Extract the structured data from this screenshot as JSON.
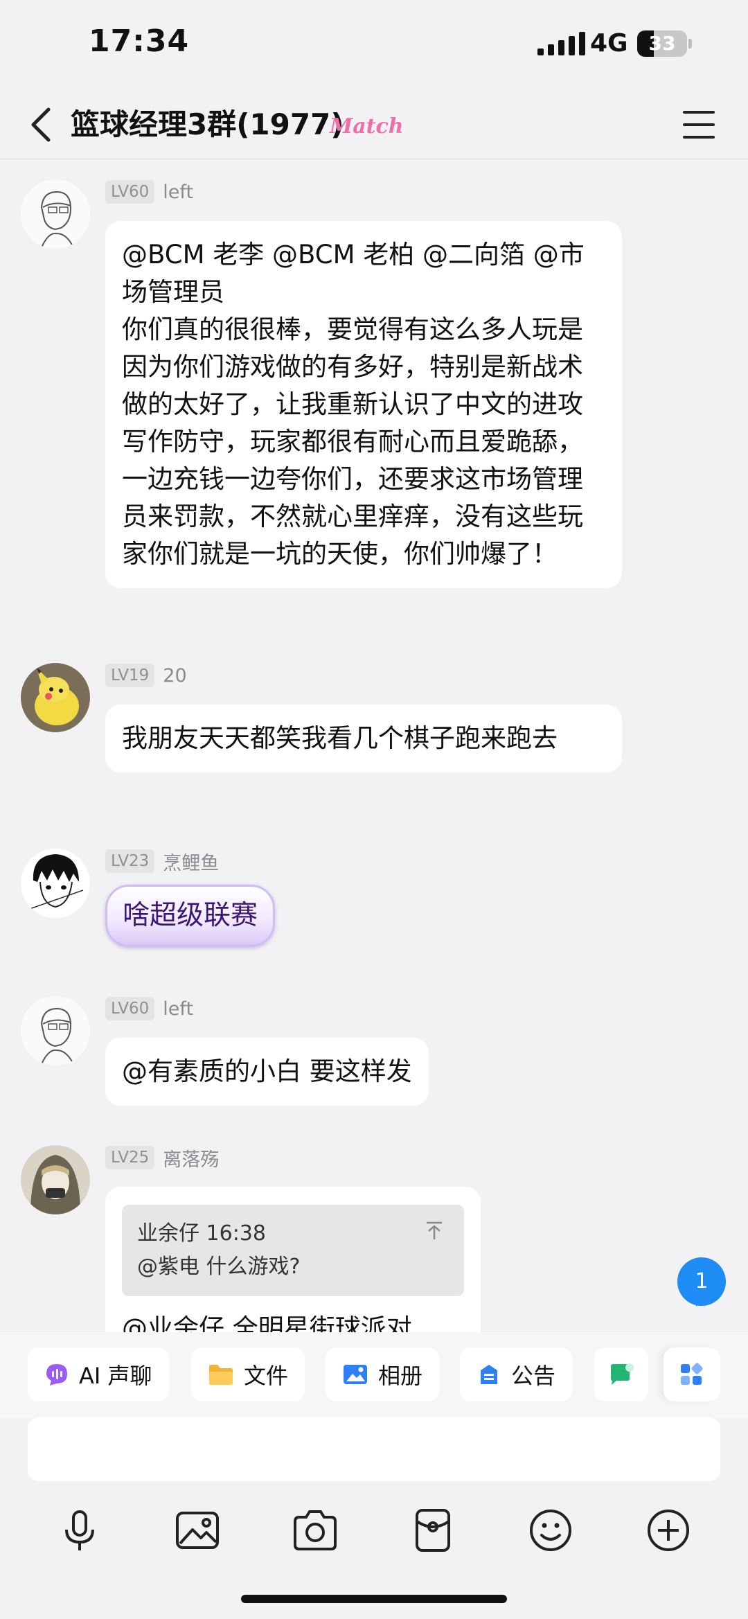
{
  "status": {
    "time": "17:34",
    "network": "4G",
    "battery": "33",
    "battery_level_percent": 33
  },
  "header": {
    "title": "篮球经理3群(1977)",
    "tag": "Match"
  },
  "messages": [
    {
      "level": "LV60",
      "nickname": "left",
      "avatar": "sketch-portrait-avatar",
      "text": "@BCM 老李 @BCM 老柏 @二向箔 @市场管理员\n你们真的很很棒，要觉得有这么多人玩是因为你们游戏做的有多好，特别是新战术做的太好了，让我重新认识了中文的进攻写作防守，玩家都很有耐心而且爱跪舔，一边充钱一边夸你们，还要求这市场管理员来罚款，不然就心里痒痒，没有这些玩家你们就是一坑的天使，你们帅爆了！"
    },
    {
      "level": "LV19",
      "nickname": "20",
      "avatar": "yellow-plush-avatar",
      "text": "我朋友天天都笑我看几个棋子跑来跑去"
    },
    {
      "level": "LV23",
      "nickname": "烹鲤鱼",
      "avatar": "manga-boy-avatar",
      "text": "啥超级联赛"
    },
    {
      "level": "LV60",
      "nickname": "left",
      "avatar": "sketch-portrait-avatar",
      "text": "@有素质的小白 要这样发"
    },
    {
      "level": "LV25",
      "nickname": "离落殇",
      "avatar": "hooded-girl-avatar",
      "quote": {
        "author_time": "业余仔 16:38",
        "text": "@紫电 什么游戏?"
      },
      "text": "@业余仔 全明星街球派对"
    }
  ],
  "unread_count": "1",
  "quick_actions": [
    {
      "label": "AI 声聊",
      "icon": "ai-voice-icon",
      "color": "#9b5cf6"
    },
    {
      "label": "文件",
      "icon": "folder-icon",
      "color": "#f5b335"
    },
    {
      "label": "相册",
      "icon": "album-icon",
      "color": "#2f7ff5"
    },
    {
      "label": "公告",
      "icon": "announcement-icon",
      "color": "#2f7ff5"
    }
  ],
  "input": {
    "placeholder": ""
  },
  "toolbar": [
    "microphone-icon",
    "image-icon",
    "camera-icon",
    "red-packet-icon",
    "emoji-icon",
    "plus-icon"
  ]
}
